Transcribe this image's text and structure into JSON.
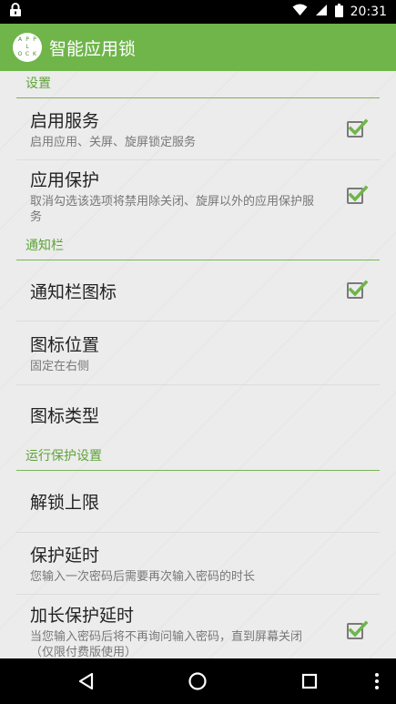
{
  "status_bar": {
    "time": "20:31",
    "icons": [
      "lock-icon",
      "wifi-icon",
      "signal-icon",
      "battery-icon"
    ]
  },
  "app_bar": {
    "title": "智能应用锁",
    "logo_letters": [
      "A",
      "P",
      "P",
      "",
      "L",
      "",
      "O",
      "C",
      "K"
    ]
  },
  "sections": [
    {
      "header": "设置",
      "items": [
        {
          "title": "启用服务",
          "summary": "启用应用、关屏、旋屏锁定服务",
          "checkbox": true,
          "checked": true
        },
        {
          "title": "应用保护",
          "summary": "取消勾选该选项将禁用除关闭、旋屏以外的应用保护服务",
          "checkbox": true,
          "checked": true
        }
      ]
    },
    {
      "header": "通知栏",
      "items": [
        {
          "title": "通知栏图标",
          "summary": "",
          "checkbox": true,
          "checked": true
        },
        {
          "title": "图标位置",
          "summary": "固定在右侧",
          "checkbox": false
        },
        {
          "title": "图标类型",
          "summary": "",
          "checkbox": false
        }
      ]
    },
    {
      "header": "运行保护设置",
      "items": [
        {
          "title": "解锁上限",
          "summary": "",
          "checkbox": false
        },
        {
          "title": "保护延时",
          "summary": "您输入一次密码后需要再次输入密码的时长",
          "checkbox": false
        },
        {
          "title": "加长保护延时",
          "summary": "当您输入密码后将不再询问输入密码，直到屏幕关闭（仅限付费版使用）",
          "checkbox": true,
          "checked": true
        }
      ]
    }
  ],
  "nav_bar": {
    "icons": [
      "back-icon",
      "home-icon",
      "recents-icon",
      "overflow-menu-icon"
    ]
  },
  "colors": {
    "accent": "#6fb54a",
    "section_text": "#5fa43a",
    "check": "#6fb54a"
  }
}
